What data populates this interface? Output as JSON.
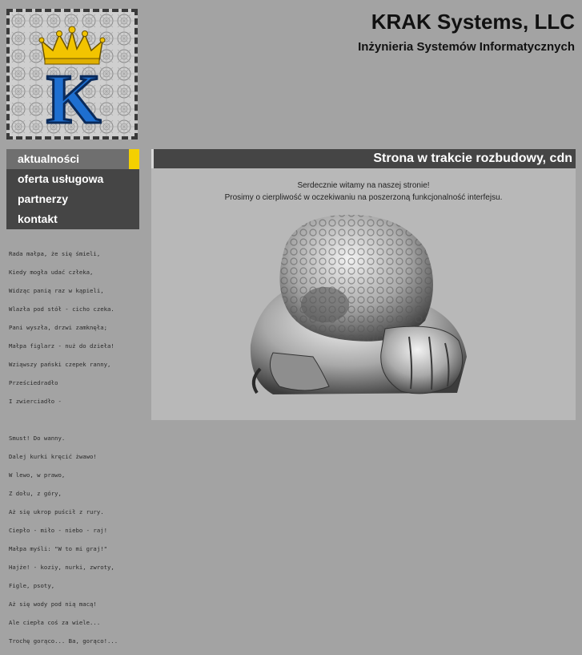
{
  "header": {
    "title": "KRAK Systems, LLC",
    "subtitle": "Inżynieria Systemów Informatycznych"
  },
  "logo": {
    "letter": "K",
    "icon": "crown-icon"
  },
  "nav": {
    "items": [
      {
        "label": "aktualności",
        "active": true
      },
      {
        "label": "oferta usługowa",
        "active": false
      },
      {
        "label": "partnerzy",
        "active": false
      },
      {
        "label": "kontakt",
        "active": false
      }
    ]
  },
  "poem": {
    "lines": [
      "Rada małpa, że się śmieli,",
      "Kiedy mogła udać człeka,",
      "Widząc panią raz w kąpieli,",
      "Wlazła pod stół - cicho czeka.",
      "Pani wyszła, drzwi zamknęła;",
      "Małpa figlarz - nuż do dzieła!",
      "Wziąwszy pański czepek ranny,",
      "Prześciedradło",
      "I zwierciadło -",
      "",
      "Smust! Do wanny.",
      "Dalej kurki kręcić żwawo!",
      "W lewo, w prawo,",
      "Z dołu, z góry,",
      "Aż się ukrop puścił z rury.",
      "Ciepło - miło - niebo - raj!",
      "Małpa myśli: \"W to mi graj!\"",
      "Hajże! - koziy, nurki, zwroty,",
      "Figle, psoty,",
      "Aż się wody pod nią macą!",
      "Ale ciepła coś za wiele...",
      "Trochę gorąco... Ba, gorąco!..."
    ]
  },
  "main": {
    "heading": "Strona w trakcie rozbudowy, cdn",
    "welcome": "Serdecznie witamy na naszej stronie!",
    "notice": "Prosimy o cierpliwość w oczekiwaniu na poszerzoną funkcjonalność interfejsu."
  },
  "colors": {
    "background": "#a3a3a3",
    "nav_bg": "#454545",
    "nav_active": "#6f6f6f",
    "accent": "#f4d000",
    "logo_letter": "#1e6fd0",
    "crown": "#f2c400"
  }
}
